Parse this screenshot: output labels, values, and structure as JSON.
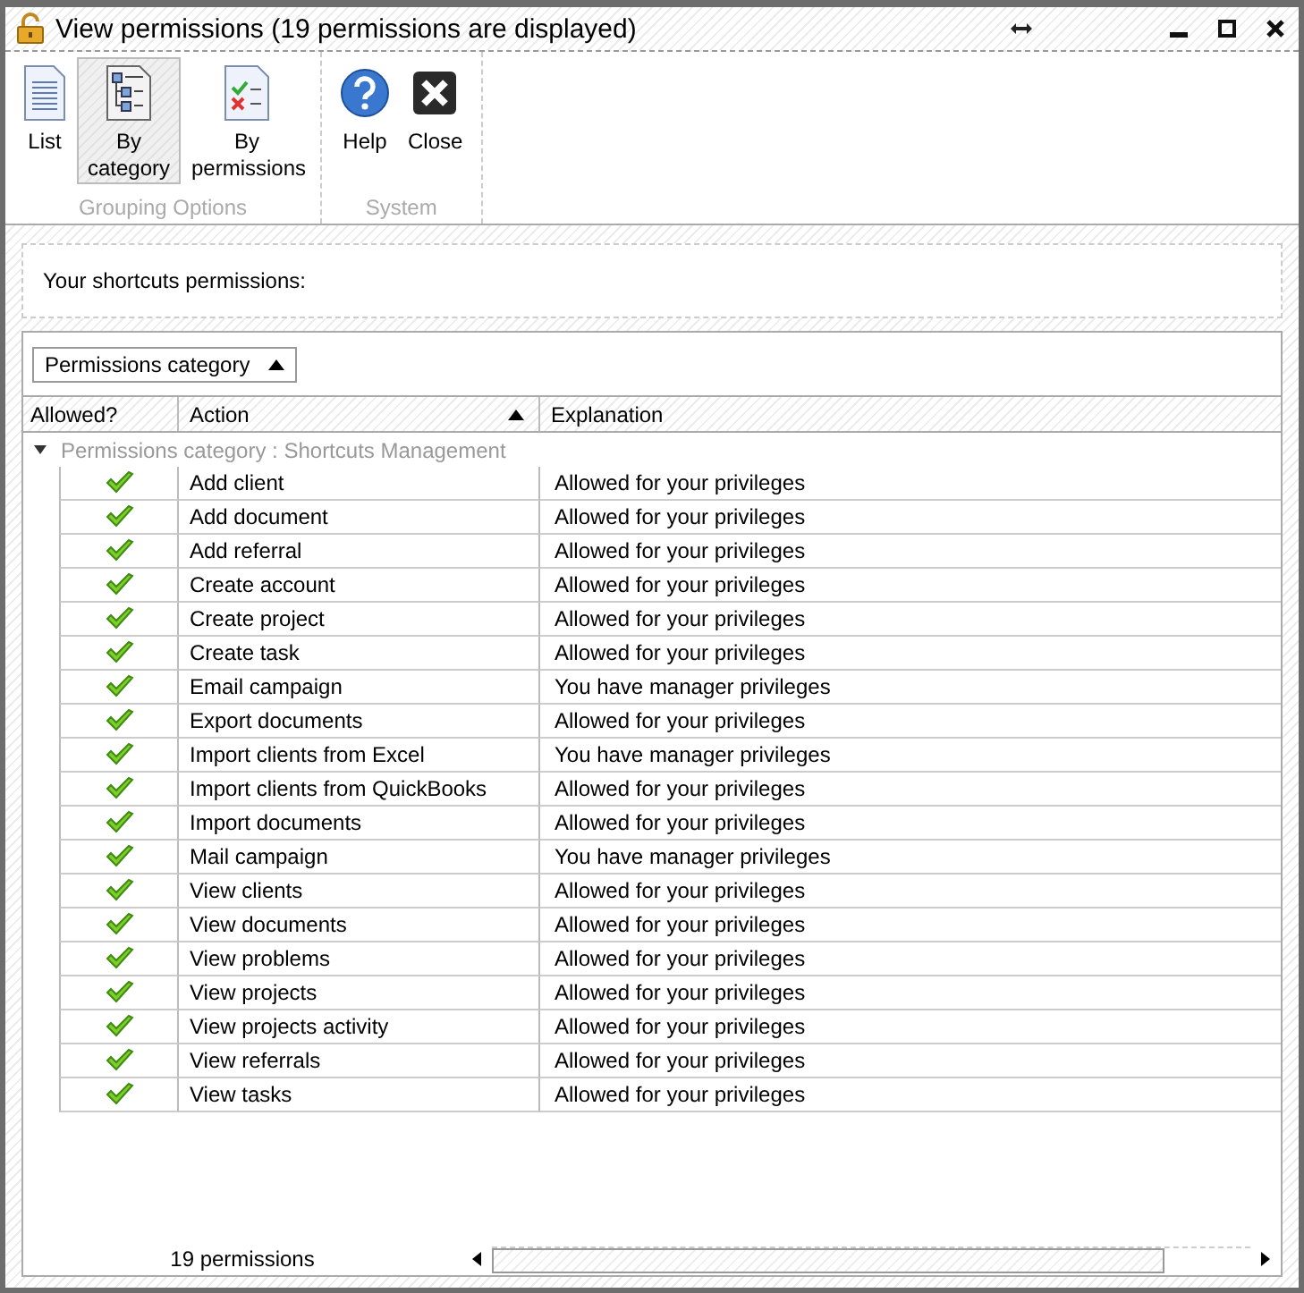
{
  "window": {
    "title": "View permissions (19 permissions are displayed)"
  },
  "toolbar": [
    {
      "label": "Grouping Options",
      "buttons": [
        {
          "kind": "list",
          "label": "List",
          "selected": false
        },
        {
          "kind": "category",
          "label": "By category",
          "selected": true
        },
        {
          "kind": "permissions",
          "label": "By permissions",
          "selected": false
        }
      ]
    },
    {
      "label": "System",
      "buttons": [
        {
          "kind": "help",
          "label": "Help",
          "selected": false
        },
        {
          "kind": "close",
          "label": "Close",
          "selected": false
        }
      ]
    }
  ],
  "panel": {
    "text": "Your shortcuts permissions:"
  },
  "grouping": {
    "label": "Permissions category"
  },
  "table": {
    "columns": [
      "Allowed?",
      "Action",
      "Explanation"
    ],
    "group": "Permissions category : Shortcuts Management",
    "rows": [
      {
        "allowed": true,
        "action": "Add client",
        "explanation": "Allowed for your privileges"
      },
      {
        "allowed": true,
        "action": "Add document",
        "explanation": "Allowed for your privileges"
      },
      {
        "allowed": true,
        "action": "Add referral",
        "explanation": "Allowed for your privileges"
      },
      {
        "allowed": true,
        "action": "Create account",
        "explanation": "Allowed for your privileges"
      },
      {
        "allowed": true,
        "action": "Create project",
        "explanation": "Allowed for your privileges"
      },
      {
        "allowed": true,
        "action": "Create task",
        "explanation": "Allowed for your privileges"
      },
      {
        "allowed": true,
        "action": "Email campaign",
        "explanation": "You have manager privileges"
      },
      {
        "allowed": true,
        "action": "Export documents",
        "explanation": "Allowed for your privileges"
      },
      {
        "allowed": true,
        "action": "Import clients from Excel",
        "explanation": "You have manager privileges"
      },
      {
        "allowed": true,
        "action": "Import clients from QuickBooks",
        "explanation": "Allowed for your privileges"
      },
      {
        "allowed": true,
        "action": "Import documents",
        "explanation": "Allowed for your privileges"
      },
      {
        "allowed": true,
        "action": "Mail campaign",
        "explanation": "You have manager privileges"
      },
      {
        "allowed": true,
        "action": "View clients",
        "explanation": "Allowed for your privileges"
      },
      {
        "allowed": true,
        "action": "View documents",
        "explanation": "Allowed for your privileges"
      },
      {
        "allowed": true,
        "action": "View problems",
        "explanation": "Allowed for your privileges"
      },
      {
        "allowed": true,
        "action": "View projects",
        "explanation": "Allowed for your privileges"
      },
      {
        "allowed": true,
        "action": "View projects activity",
        "explanation": "Allowed for your privileges"
      },
      {
        "allowed": true,
        "action": "View referrals",
        "explanation": "Allowed for your privileges"
      },
      {
        "allowed": true,
        "action": "View tasks",
        "explanation": "Allowed for your privileges"
      }
    ],
    "footer": "19 permissions"
  }
}
